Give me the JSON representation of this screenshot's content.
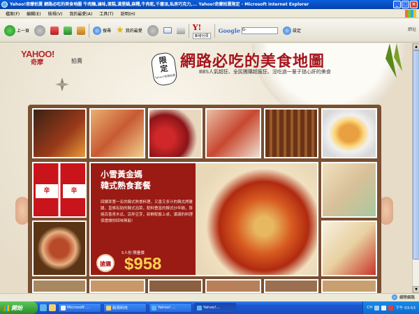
{
  "window": {
    "title": "Yahoo!奇摩拍賣 網路必吃的美食地圖 牛肉麵,滷味,蛋糕,漢堡鍋,麻糬,牛肉乾,千層派,私房巧克力,... Yahoo!奇摩拍賣限定 - Microsoft Internet Explorer",
    "controls": [
      "_",
      "□",
      "×"
    ]
  },
  "menu": [
    "檔案(F)",
    "編輯(E)",
    "檢視(V)",
    "我的最愛(A)",
    "工具(T)",
    "說明(H)"
  ],
  "toolbar": {
    "back_label": "上一頁",
    "search_label": "搜尋",
    "favorites_label": "我的最愛",
    "new_tab_label": "新增分頁",
    "google_label": "Google",
    "google_value": "G-",
    "settings_label": "設定",
    "right_label": "網址"
  },
  "page": {
    "brand": {
      "logo": "YAHOO!",
      "kimo": "奇摩",
      "auction": "拍賣"
    },
    "badge": {
      "big1": "限",
      "big2": "定",
      "small": "Yahoo!奇摩拍賣"
    },
    "title": "網路必吃的美食地圖",
    "subtitle": "BBS人氣超狂、全民團購超瘋狂、沒吃過一輩子搥心肝的美食",
    "feature": {
      "title_line1": "小雪黃金媽",
      "title_line2": "韓式熟食套餐",
      "description": "回饋率第一名的韓式熟食料理，又香又多汁的韓式烤雞腿，直條有勁的韓式泡菜，配料豐富的韓式炒年糕，厚燒百香青木瓜、涼拌豆芽，新鮮配飯上桌，滿滿的料理保證讓你回味無窮!",
      "buy_label": "搶購",
      "price_sub": "5人份 限量價",
      "price": "$958"
    },
    "can_label": "辛"
  },
  "statusbar": {
    "text": "",
    "zone": "網際網路"
  },
  "taskbar": {
    "start": "開始",
    "tasks": [
      "Microsoft ...",
      "新資料夾",
      "Yahoo! ...",
      "Yahoo!..."
    ],
    "tray_lang": "CH",
    "clock": "下午 03:53"
  }
}
